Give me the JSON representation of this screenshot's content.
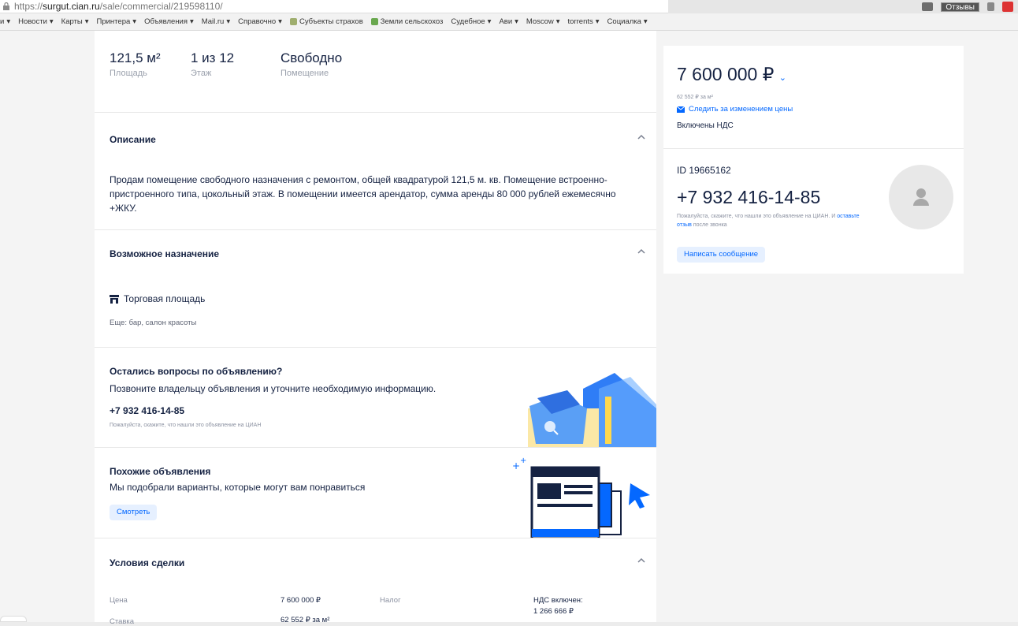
{
  "browser": {
    "url_prefix": "https://",
    "url_host": "surgut.cian.ru",
    "url_path": "/sale/commercial/219598110/",
    "feedback_label": "Отзывы"
  },
  "bookmarks": [
    "и",
    "Новости",
    "Карты",
    "Принтера",
    "Объявления",
    "Mail.ru",
    "Справочно",
    "Субъекты страхов",
    "Земли сельскохоз",
    "Судебное",
    "Ави",
    "Moscow",
    "torrents",
    "Социалка"
  ],
  "stats": [
    {
      "value": "121,5 м²",
      "label": "Площадь"
    },
    {
      "value": "1 из 12",
      "label": "Этаж"
    },
    {
      "value": "Свободно",
      "label": "Помещение"
    }
  ],
  "description": {
    "title": "Описание",
    "text": "Продам помещение свободного назначения с ремонтом, общей квадратурой 121,5 м. кв. Помещение встроенно-пристроенного типа, цокольный этаж. В помещении имеется арендатор, сумма аренды 80 000 рублей ежемесячно +ЖКУ."
  },
  "purpose": {
    "title": "Возможное назначение",
    "item": "Торговая площадь",
    "more": "Еще: бар, салон красоты"
  },
  "questions": {
    "title": "Остались вопросы по объявлению?",
    "subtitle": "Позвоните владельцу объявления и уточните необходимую информацию.",
    "phone": "+7 932 416-14-85",
    "note": "Пожалуйста, скажите, что нашли это объявление на ЦИАН"
  },
  "similar": {
    "title": "Похожие объявления",
    "subtitle": "Мы подобрали варианты, которые могут вам понравиться",
    "button": "Смотреть"
  },
  "deal": {
    "title": "Условия сделки",
    "price_label": "Цена",
    "price_value": "7 600 000 ₽",
    "tax_label": "Налог",
    "tax_value_1": "НДС включен:",
    "tax_value_2": "1 266 666 ₽",
    "rate_label": "Ставка",
    "rate_value": "62 552 ₽ за м²"
  },
  "price_card": {
    "price": "7 600 000 ₽",
    "per_m2": "62 552 ₽ за м²",
    "follow": "Следить за изменением цены",
    "vat": "Включены НДС"
  },
  "contact": {
    "id": "ID 19665162",
    "phone": "+7 932 416-14-85",
    "note_start": "Пожалуйста, скажите, что нашли это объявление на ЦИАН. И ",
    "note_link": "оставьте отзыв",
    "note_end": " после звонка",
    "message_button": "Написать сообщение"
  },
  "colors": {
    "accent": "#0468ff",
    "text": "#152242",
    "muted": "#8a90a0"
  }
}
